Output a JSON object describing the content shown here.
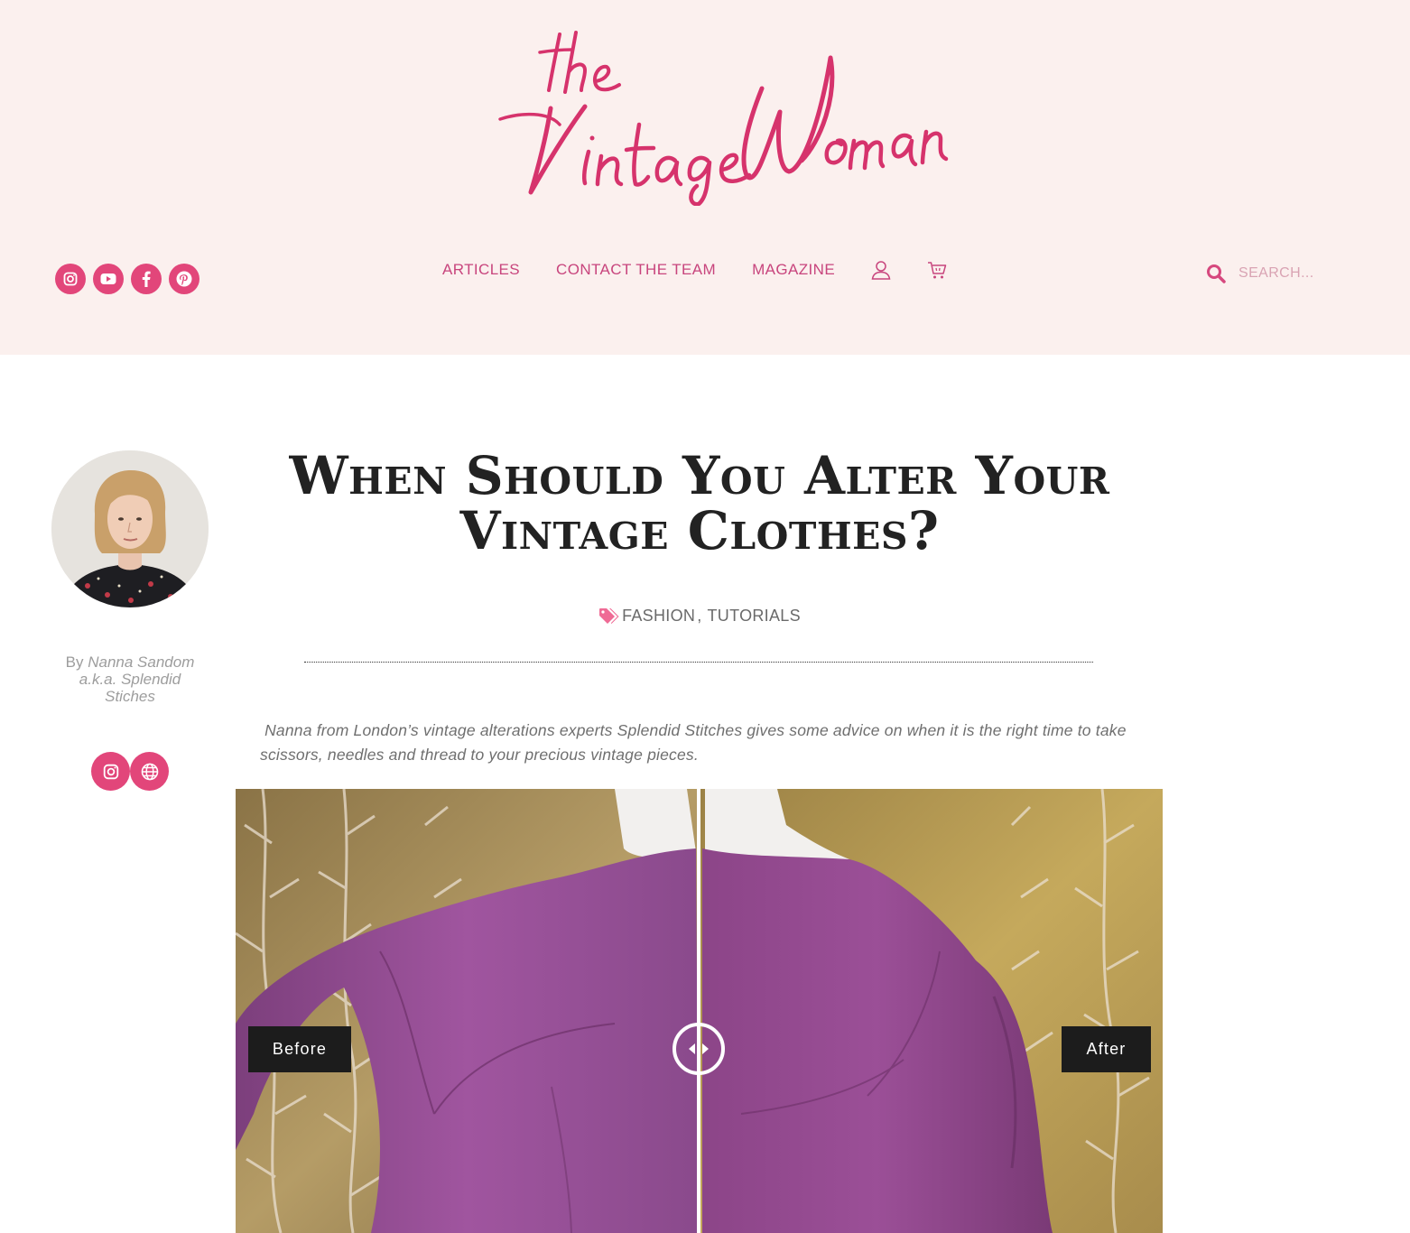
{
  "site": {
    "logo_text_top": "the",
    "logo_text_main": "Vintage Woman",
    "brand_color": "#e2467a",
    "nav_color": "#c8457d",
    "header_bg": "#fbf0ee"
  },
  "social": [
    "instagram-icon",
    "youtube-icon",
    "facebook-icon",
    "pinterest-icon"
  ],
  "nav": {
    "items": [
      "ARTICLES",
      "CONTACT THE TEAM",
      "MAGAZINE"
    ],
    "icons": [
      "user-icon",
      "cart-icon"
    ]
  },
  "search": {
    "placeholder": "SEARCH..."
  },
  "author": {
    "by": "By",
    "name": "Nanna Sandom a.k.a. Splendid Stiches",
    "links": [
      "instagram-icon",
      "globe-icon"
    ]
  },
  "article": {
    "title": "When Should You Alter Your Vintage Clothes?",
    "categories": [
      "FASHION",
      "TUTORIALS"
    ],
    "category_separator": ",",
    "intro": " Nanna from London’s vintage alterations experts Splendid Stitches gives some advice on when it is the right time to take scissors, needles and thread to your precious vintage pieces."
  },
  "comparison": {
    "before_label": "Before",
    "after_label": "After",
    "slider_position": 0.5
  }
}
